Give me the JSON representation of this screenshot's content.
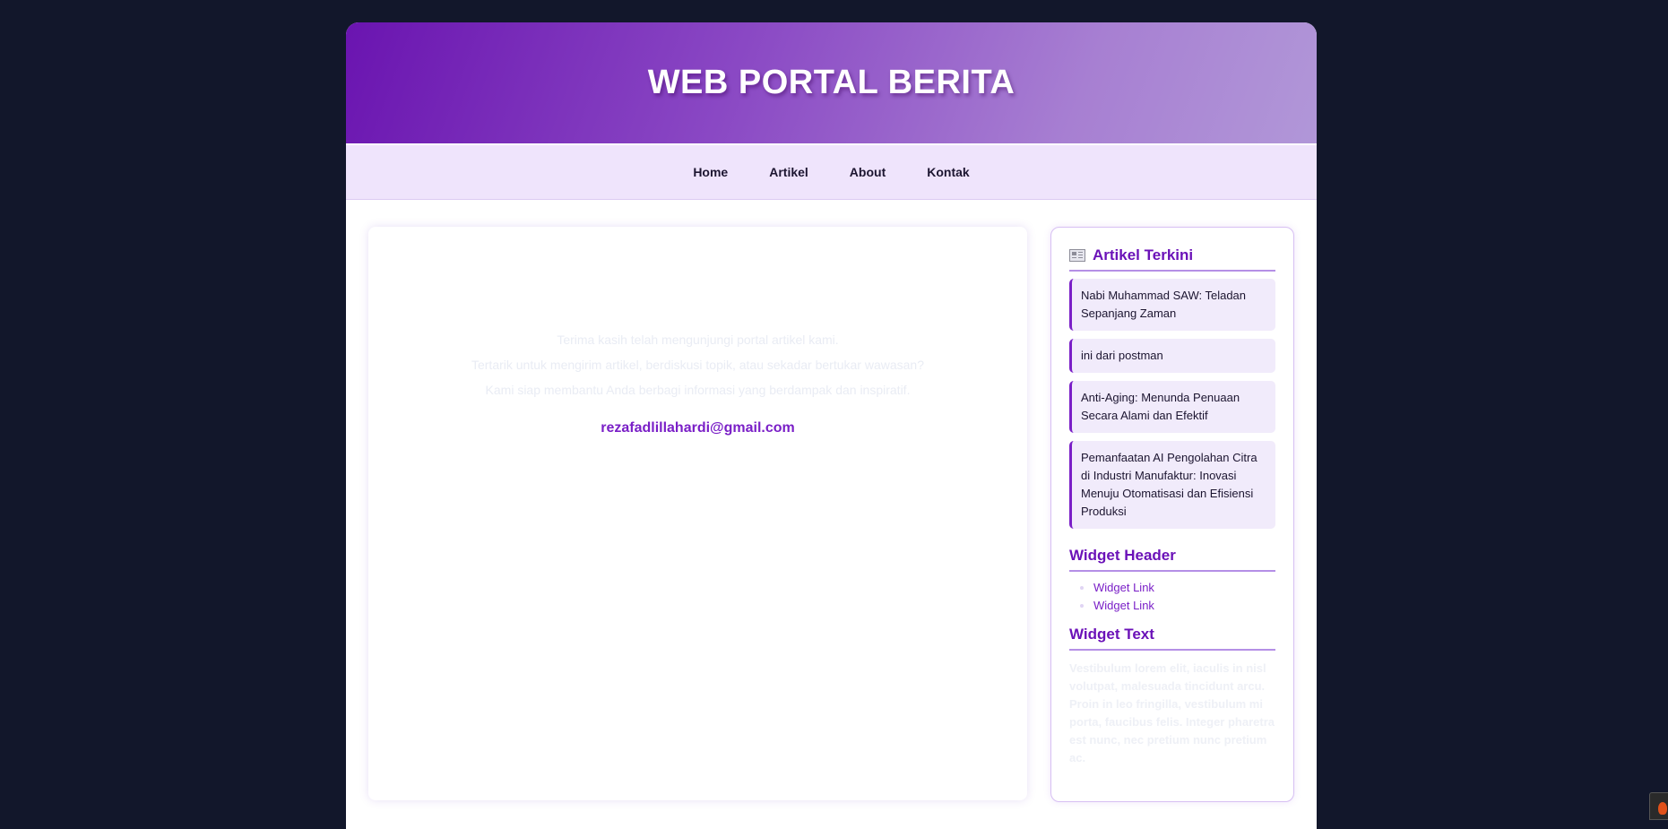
{
  "header": {
    "title": "WEB PORTAL BERITA"
  },
  "nav": {
    "items": [
      "Home",
      "Artikel",
      "About",
      "Kontak"
    ]
  },
  "main": {
    "messages": [
      "Terima kasih telah mengunjungi portal artikel kami.",
      "Tertarik untuk mengirim artikel, berdiskusi topik, atau sekadar bertukar wawasan?",
      "Kami siap membantu Anda berbagi informasi yang berdampak dan inspiratif."
    ],
    "email": "rezafadlillahardi@gmail.com"
  },
  "sidebar": {
    "recent": {
      "icon": "newspaper-icon",
      "title": "Artikel Terkini",
      "items": [
        "Nabi Muhammad SAW: Teladan Sepanjang Zaman",
        "ini dari postman",
        "Anti-Aging: Menunda Penuaan Secara Alami dan Efektif",
        "Pemanfaatan AI Pengolahan Citra di Industri Manufaktur: Inovasi Menuju Otomatisasi dan Efisiensi Produksi"
      ]
    },
    "widget_header": {
      "title": "Widget Header",
      "links": [
        "Widget Link",
        "Widget Link"
      ]
    },
    "widget_text": {
      "title": "Widget Text",
      "body": "Vestibulum lorem elit, iaculis in nisl volutpat, malesuada tincidunt arcu. Proin in leo fringilla, vestibulum mi porta, faucibus felis. Integer pharetra est nunc, nec pretium nunc pretium ac."
    }
  },
  "colors": {
    "background": "#12172b",
    "accent": "#7a1fc7",
    "nav_background": "#efe4fc"
  }
}
